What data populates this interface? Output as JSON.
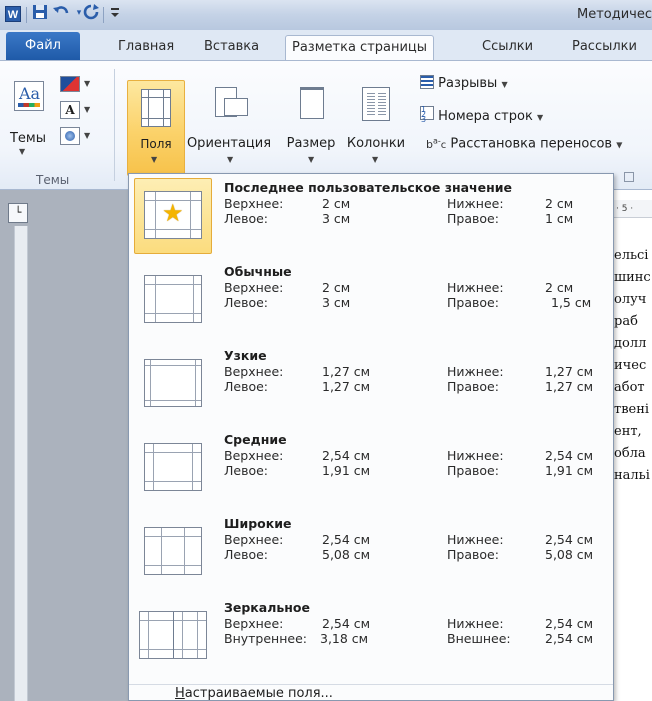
{
  "titlebar": {
    "app_icon": "W",
    "title": "Методичес",
    "qa_icons": [
      "save-icon",
      "undo-icon",
      "redo-icon",
      "customize-icon"
    ]
  },
  "tabs": [
    {
      "label": "Файл"
    },
    {
      "label": "Главная"
    },
    {
      "label": "Вставка"
    },
    {
      "label": "Разметка страницы"
    },
    {
      "label": "Ссылки"
    },
    {
      "label": "Рассылки"
    }
  ],
  "ribbon": {
    "themes_label": "Темы",
    "themes_group": "Темы",
    "fields_label": "Поля",
    "orientation_label": "Ориентация",
    "size_label": "Размер",
    "columns_label": "Колонки",
    "breaks_label": "Разрывы",
    "line_numbers_label": "Номера строк",
    "hyphenation_label": "Расстановка переносов"
  },
  "menu": {
    "options": [
      {
        "name": "Последнее пользовательское значение",
        "l1": "Верхнее:",
        "v1": "2 см",
        "l2": "Нижнее:",
        "v2": "2 см",
        "l3": "Левое:",
        "v3": "3 см",
        "l4": "Правое:",
        "v4": "1 см",
        "selected": true
      },
      {
        "name": "Обычные",
        "l1": "Верхнее:",
        "v1": "2 см",
        "l2": "Нижнее:",
        "v2": "2 см",
        "l3": "Левое:",
        "v3": "3 см",
        "l4": "Правое:",
        "v4": "1,5 см"
      },
      {
        "name": "Узкие",
        "l1": "Верхнее:",
        "v1": "1,27 см",
        "l2": "Нижнее:",
        "v2": "1,27 см",
        "l3": "Левое:",
        "v3": "1,27 см",
        "l4": "Правое:",
        "v4": "1,27 см"
      },
      {
        "name": "Средние",
        "l1": "Верхнее:",
        "v1": "2,54 см",
        "l2": "Нижнее:",
        "v2": "2,54 см",
        "l3": "Левое:",
        "v3": "1,91 см",
        "l4": "Правое:",
        "v4": "1,91 см"
      },
      {
        "name": "Широкие",
        "l1": "Верхнее:",
        "v1": "2,54 см",
        "l2": "Нижнее:",
        "v2": "2,54 см",
        "l3": "Левое:",
        "v3": "5,08 см",
        "l4": "Правое:",
        "v4": "5,08 см"
      },
      {
        "name": "Зеркальное",
        "l1": "Верхнее:",
        "v1": "2,54 см",
        "l2": "Нижнее:",
        "v2": "2,54 см",
        "l3": "Внутреннее:",
        "v3": "3,18 см",
        "l4": "Внешнее:",
        "v4": "2,54 см"
      }
    ],
    "custom_first": "Н",
    "custom_rest": "астраиваемые поля..."
  },
  "doc": {
    "ruler": "· 5 ·",
    "lines": [
      "ельсі",
      "шинс",
      "олуч",
      " раб",
      " долл",
      "ичес",
      "абот",
      "твені",
      "ент, ",
      " обла",
      "нальі"
    ]
  },
  "colors": {
    "accent": "#2a5daa",
    "selected_fill": "#fbd26a",
    "menu_bg": "#fbfcfd"
  }
}
